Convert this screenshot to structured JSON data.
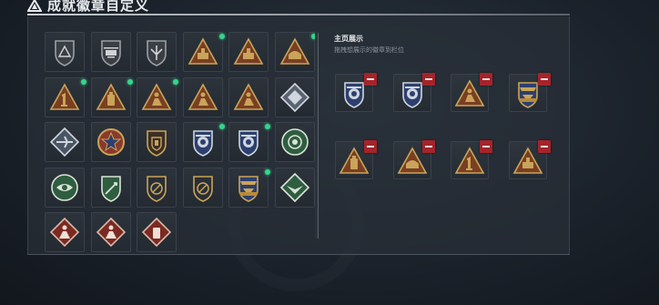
{
  "header": {
    "title": "成就徽章自定义",
    "icon": "warning-triangle-icon"
  },
  "display": {
    "title": "主页展示",
    "subtitle": "拖拽想展示的徽章到栏位"
  },
  "colors": {
    "accent_green": "#35d58b",
    "remove_red": "#a4242a",
    "gold": "#c9a45a",
    "bronze": "#8a4a2a",
    "silver": "#cfd6df",
    "navy": "#2d3f6e"
  },
  "badges": [
    {
      "icon": "triangle-plain-badge-icon",
      "new": false
    },
    {
      "icon": "helicopter-badge-icon",
      "new": false
    },
    {
      "icon": "winged-shield-badge-icon",
      "new": false
    },
    {
      "icon": "bronze-triangle-tank-badge-icon",
      "new": true
    },
    {
      "icon": "bronze-triangle-tank-badge-icon",
      "new": false
    },
    {
      "icon": "bronze-triangle-ship-badge-icon",
      "new": true
    },
    {
      "icon": "bronze-triangle-number-one-badge-icon",
      "new": true
    },
    {
      "icon": "bronze-triangle-bottle-badge-icon",
      "new": true
    },
    {
      "icon": "bronze-triangle-figure-badge-icon",
      "new": true
    },
    {
      "icon": "bronze-triangle-figure-badge-icon",
      "new": false
    },
    {
      "icon": "bronze-triangle-figure-badge-icon",
      "new": false
    },
    {
      "icon": "silver-diamond-badge-icon",
      "new": false
    },
    {
      "icon": "silver-aircraft-diamond-badge-icon",
      "new": false
    },
    {
      "icon": "star-medal-badge-icon",
      "new": false
    },
    {
      "icon": "crest-shield-badge-icon",
      "new": false
    },
    {
      "icon": "police-shield-badge-icon",
      "new": true
    },
    {
      "icon": "police-shield-badge-icon",
      "new": true
    },
    {
      "icon": "green-wreath-badge-icon",
      "new": false
    },
    {
      "icon": "green-eye-wreath-badge-icon",
      "new": false
    },
    {
      "icon": "green-sword-shield-badge-icon",
      "new": false
    },
    {
      "icon": "dark-shield-badge-icon",
      "new": false
    },
    {
      "icon": "dark-shield-badge-icon",
      "new": false
    },
    {
      "icon": "gold-eagle-crest-badge-icon",
      "new": true
    },
    {
      "icon": "green-eagle-diamond-badge-icon",
      "new": false
    },
    {
      "icon": "red-figure-diamond-badge-icon",
      "new": false
    },
    {
      "icon": "red-figure-diamond-badge-icon",
      "new": false
    },
    {
      "icon": "red-bottle-diamond-badge-icon",
      "new": false
    }
  ],
  "displayed_badges": [
    {
      "icon": "police-shield-badge-icon"
    },
    {
      "icon": "police-shield-badge-icon"
    },
    {
      "icon": "bronze-triangle-figure-badge-icon"
    },
    {
      "icon": "gold-eagle-crest-badge-icon"
    },
    {
      "icon": "bronze-triangle-bottle-badge-icon"
    },
    {
      "icon": "bronze-triangle-ship-badge-icon"
    },
    {
      "icon": "bronze-triangle-number-one-badge-icon"
    },
    {
      "icon": "bronze-triangle-tank-badge-icon"
    }
  ]
}
